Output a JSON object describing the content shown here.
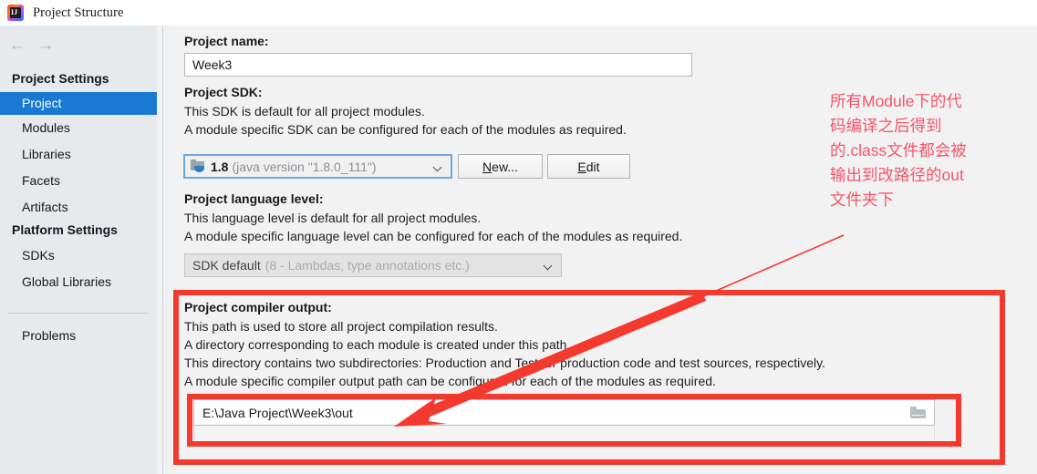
{
  "window": {
    "title": "Project Structure",
    "app_icon": "intellij-idea-icon"
  },
  "nav": {
    "back_icon": "←",
    "forward_icon": "→"
  },
  "sidebar": {
    "groups": [
      {
        "label": "Project Settings"
      },
      {
        "label": "Platform Settings"
      }
    ],
    "items": [
      {
        "label": "Project",
        "selected": true
      },
      {
        "label": "Modules",
        "selected": false
      },
      {
        "label": "Libraries",
        "selected": false
      },
      {
        "label": "Facets",
        "selected": false
      },
      {
        "label": "Artifacts",
        "selected": false
      },
      {
        "label": "SDKs",
        "selected": false
      },
      {
        "label": "Global Libraries",
        "selected": false
      },
      {
        "label": "Problems",
        "selected": false
      }
    ]
  },
  "main": {
    "project_name": {
      "label": "Project name:",
      "value": "Week3"
    },
    "project_sdk": {
      "label": "Project SDK:",
      "desc_line1": "This SDK is default for all project modules.",
      "desc_line2": "A module specific SDK can be configured for each of the modules as required.",
      "combo_version": "1.8",
      "combo_detail": "(java version \"1.8.0_111\")",
      "new_button": "New...",
      "new_button_mnemonic": "N",
      "new_button_rest": "ew...",
      "edit_button": "Edit",
      "edit_button_mnemonic": "E",
      "edit_button_rest": "dit"
    },
    "language_level": {
      "label": "Project language level:",
      "desc_line1": "This language level is default for all project modules.",
      "desc_line2": "A module specific language level can be configured for each of the modules as required.",
      "combo_value": "SDK default",
      "combo_detail": "(8 - Lambdas, type annotations etc.)"
    },
    "compiler_output": {
      "label": "Project compiler output:",
      "desc_line1": "This path is used to store all project compilation results.",
      "desc_line2": "A directory corresponding to each module is created under this path.",
      "desc_line3": "This directory contains two subdirectories: Production and Test for production code and test sources, respectively.",
      "desc_line4": "A module specific compiler output path can be configured for each of the modules as required.",
      "path_value": "E:\\Java Project\\Week3\\out",
      "browse_icon": "folder-icon"
    }
  },
  "annotation": {
    "text": "所有Module下的代\n码编译之后得到\n的.class文件都会被\n输出到改路径的out\n文件夹下",
    "color": "#f4566a",
    "highlight_color": "#f4392f"
  }
}
